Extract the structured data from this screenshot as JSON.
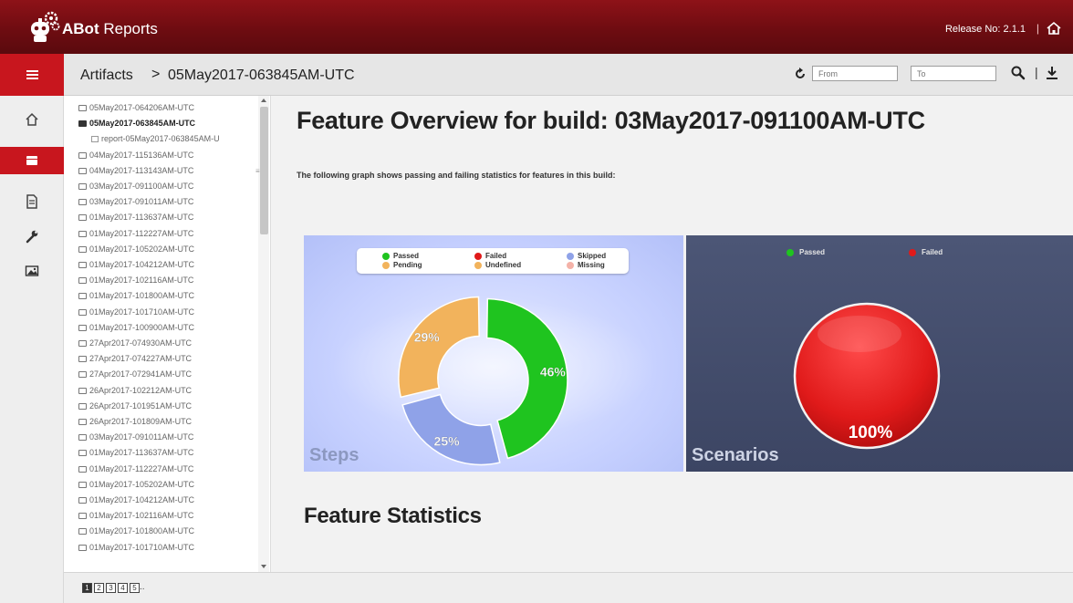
{
  "header": {
    "brand_bold": "ABot",
    "brand_rest": "Reports",
    "release": "Release No: 2.1.1",
    "separator": "|"
  },
  "subheader": {
    "crumb_root": "Artifacts",
    "crumb_sep": ">",
    "crumb_current": "05May2017-063845AM-UTC",
    "from_placeholder": "From",
    "to_placeholder": "To",
    "separator": "|"
  },
  "tree": {
    "items": [
      {
        "label": "05May2017-064206AM-UTC"
      },
      {
        "label": "05May2017-063845AM-UTC",
        "open": true
      },
      {
        "label": "report-05May2017-063845AM-U",
        "child": true
      },
      {
        "label": "04May2017-115136AM-UTC"
      },
      {
        "label": "04May2017-113143AM-UTC"
      },
      {
        "label": "03May2017-091100AM-UTC"
      },
      {
        "label": "03May2017-091011AM-UTC"
      },
      {
        "label": "01May2017-113637AM-UTC"
      },
      {
        "label": "01May2017-112227AM-UTC"
      },
      {
        "label": "01May2017-105202AM-UTC"
      },
      {
        "label": "01May2017-104212AM-UTC"
      },
      {
        "label": "01May2017-102116AM-UTC"
      },
      {
        "label": "01May2017-101800AM-UTC"
      },
      {
        "label": "01May2017-101710AM-UTC"
      },
      {
        "label": "01May2017-100900AM-UTC"
      },
      {
        "label": "27Apr2017-074930AM-UTC"
      },
      {
        "label": "27Apr2017-074227AM-UTC"
      },
      {
        "label": "27Apr2017-072941AM-UTC"
      },
      {
        "label": "26Apr2017-102212AM-UTC"
      },
      {
        "label": "26Apr2017-101951AM-UTC"
      },
      {
        "label": "26Apr2017-101809AM-UTC"
      },
      {
        "label": "03May2017-091011AM-UTC"
      },
      {
        "label": "01May2017-113637AM-UTC"
      },
      {
        "label": "01May2017-112227AM-UTC"
      },
      {
        "label": "01May2017-105202AM-UTC"
      },
      {
        "label": "01May2017-104212AM-UTC"
      },
      {
        "label": "01May2017-102116AM-UTC"
      },
      {
        "label": "01May2017-101800AM-UTC"
      },
      {
        "label": "01May2017-101710AM-UTC"
      }
    ]
  },
  "pagination": {
    "pages": [
      "1",
      "2",
      "3",
      "4",
      "5"
    ],
    "active": "1",
    "ellipsis": ".."
  },
  "main": {
    "title": "Feature Overview for build: 03May2017-091100AM-UTC",
    "intro": "The following graph shows passing and failing statistics for features in this build:",
    "stats_title": "Feature Statistics"
  },
  "colors": {
    "passed": "#1fc41f",
    "failed": "#e01a1a",
    "skipped": "#8fa2e8",
    "pending": "#f2b35c",
    "undefined": "#f2b35c",
    "missing": "#f4b2a8",
    "brand": "#8e1218",
    "accent": "#c8161e"
  },
  "icons": {
    "logo": "robot-gears-icon",
    "home": "home-icon",
    "menu": "hamburger-menu-icon",
    "reports": "list-icon",
    "document": "document-icon",
    "tools": "wrench-icon",
    "image": "image-icon",
    "refresh": "refresh-icon",
    "search": "search-icon",
    "download": "download-icon"
  },
  "chart_data": [
    {
      "type": "pie",
      "title": "Steps",
      "donut": true,
      "legend": [
        "Passed",
        "Failed",
        "Skipped",
        "Pending",
        "Undefined",
        "Missing"
      ],
      "legend_placement": "top",
      "categories": [
        "Passed",
        "Skipped",
        "Pending"
      ],
      "values": [
        46,
        25,
        29
      ],
      "value_labels": [
        "46%",
        "25%",
        "29%"
      ]
    },
    {
      "type": "pie",
      "title": "Scenarios",
      "legend": [
        "Passed",
        "Failed"
      ],
      "legend_placement": "top",
      "categories": [
        "Failed"
      ],
      "values": [
        100
      ],
      "value_labels": [
        "100%"
      ]
    }
  ]
}
